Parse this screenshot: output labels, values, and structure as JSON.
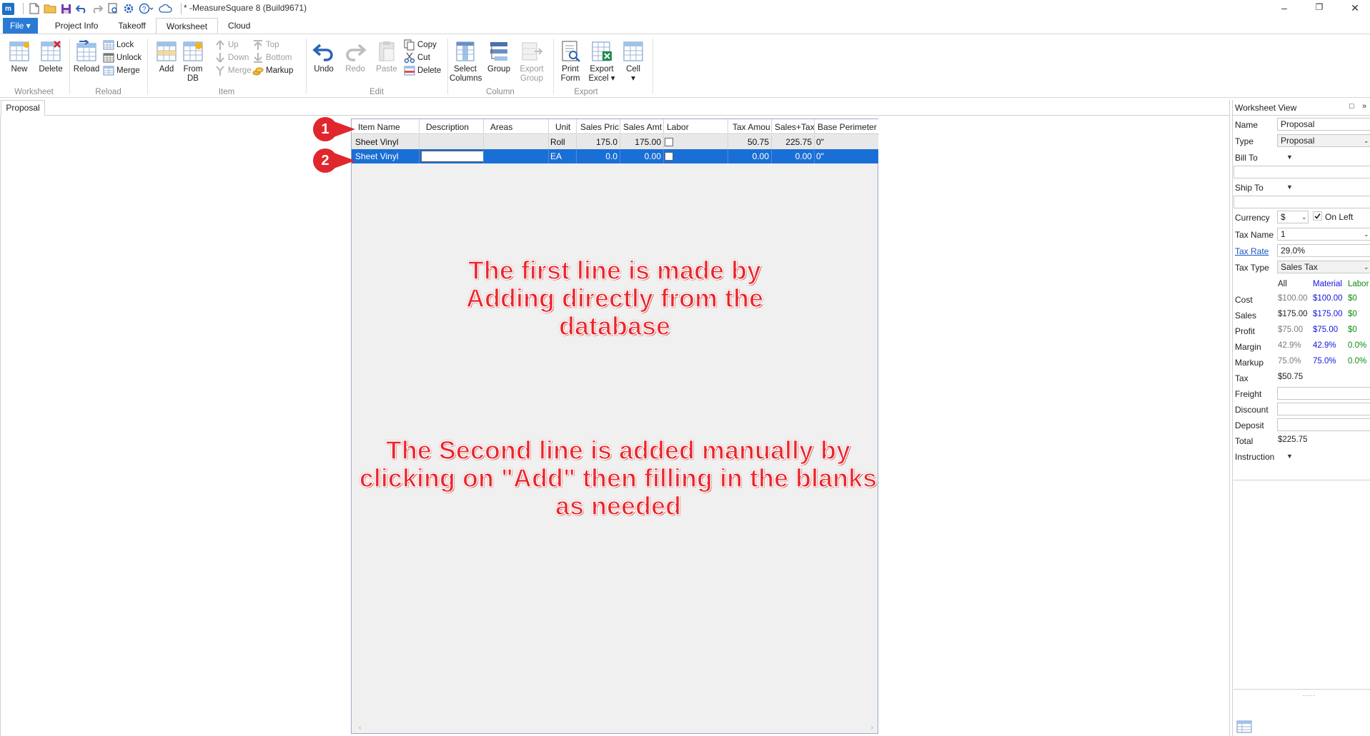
{
  "window": {
    "title": "* -MeasureSquare 8 (Build9671)",
    "logo_text": "m",
    "minimize": "–",
    "restore": "❐",
    "close": "✕"
  },
  "ribbon_tabs": [
    {
      "label": "File ▾",
      "active": false
    },
    {
      "label": "Project Info",
      "active": false
    },
    {
      "label": "Takeoff",
      "active": false
    },
    {
      "label": "Worksheet",
      "active": true
    },
    {
      "label": "Cloud",
      "active": false
    }
  ],
  "ribbon": {
    "worksheet_group": {
      "label": "Worksheet",
      "new": "New",
      "delete": "Delete"
    },
    "reload_group": {
      "label": "Reload",
      "reload": "Reload",
      "lock": "Lock",
      "unlock": "Unlock",
      "merge": "Merge"
    },
    "item_group": {
      "label": "Item",
      "add": "Add",
      "from_db_1": "From",
      "from_db_2": "DB",
      "up": "Up",
      "down": "Down",
      "merge": "Merge",
      "top": "Top",
      "bottom": "Bottom",
      "markup": "Markup"
    },
    "edit_group": {
      "label": "Edit",
      "undo": "Undo",
      "redo": "Redo",
      "paste": "Paste",
      "copy": "Copy",
      "cut": "Cut",
      "delete": "Delete"
    },
    "column_group": {
      "label": "Column",
      "select_1": "Select",
      "select_2": "Columns",
      "group": "Group",
      "export_1": "Export",
      "export_2": "Group"
    },
    "export_group": {
      "label": "Export",
      "print_1": "Print",
      "print_2": "Form",
      "excel_1": "Export",
      "excel_2": "Excel ▾",
      "cell_1": "Cell",
      "cell_2": "▾"
    }
  },
  "doc_tab": "Proposal",
  "grid": {
    "columns": [
      "Item Name",
      "Description",
      "Areas",
      "Unit",
      "Sales Pric",
      "Sales Amt",
      "Labor",
      "Tax Amou",
      "Sales+Tax",
      "Base Perimeter"
    ],
    "rows": [
      {
        "item_name": "Sheet Vinyl",
        "description": "",
        "areas": "",
        "unit": "Roll",
        "sales_price": "175.0",
        "sales_amt": "175.00",
        "tax_amount": "50.75",
        "sales_tax": "225.75",
        "base_perimeter": "0\""
      },
      {
        "item_name": "Sheet Vinyl",
        "description": "",
        "areas": "",
        "unit": "EA",
        "sales_price": "0.0",
        "sales_amt": "0.00",
        "tax_amount": "0.00",
        "sales_tax": "0.00",
        "base_perimeter": "0\""
      }
    ],
    "scroll_left": "‹",
    "scroll_right": "›"
  },
  "callouts": [
    "1",
    "2"
  ],
  "annotations": {
    "first": [
      "The first line is made by",
      "Adding directly from the",
      "database"
    ],
    "second": [
      "The Second line is added manually by",
      "clicking on \"Add\" then filling in the blanks",
      "as needed"
    ]
  },
  "panel": {
    "title": "Worksheet View",
    "pin": "□",
    "expand": "»",
    "name_label": "Name",
    "name_value": "Proposal",
    "type_label": "Type",
    "type_value": "Proposal",
    "bill_to_label": "Bill To",
    "ship_to_label": "Ship To",
    "currency_label": "Currency",
    "currency_value": "$",
    "on_left_label": "On Left",
    "tax_name_label": "Tax Name",
    "tax_name_value": "1",
    "tax_rate_label": "Tax Rate",
    "tax_rate_value": "29.0%",
    "tax_type_label": "Tax Type",
    "tax_type_value": "Sales Tax",
    "col_all": "All",
    "col_material": "Material",
    "col_labor": "Labor",
    "cost_label": "Cost",
    "cost_all": "$100.00",
    "cost_material": "$100.00",
    "cost_labor": "$0",
    "sales_label": "Sales",
    "sales_all": "$175.00",
    "sales_material": "$175.00",
    "sales_labor": "$0",
    "profit_label": "Profit",
    "profit_all": "$75.00",
    "profit_material": "$75.00",
    "profit_labor": "$0",
    "margin_label": "Margin",
    "margin_all": "42.9%",
    "margin_material": "42.9%",
    "margin_labor": "0.0%",
    "markup_label": "Markup",
    "markup_all": "75.0%",
    "markup_material": "75.0%",
    "markup_labor": "0.0%",
    "tax_label": "Tax",
    "tax_value": "$50.75",
    "freight_label": "Freight",
    "discount_label": "Discount",
    "deposit_label": "Deposit",
    "total_label": "Total",
    "total_value": "$225.75",
    "instruction_label": "Instruction",
    "grip": "....."
  },
  "colors": {
    "accent": "#2b7bd6",
    "selected_row": "#1a6fd6",
    "annotation_red": "#e8262c",
    "material_blue": "#1515e0",
    "labor_green": "#118a11"
  }
}
